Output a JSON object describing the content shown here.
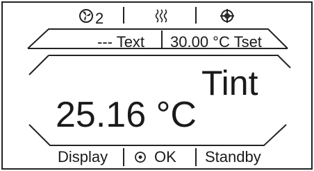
{
  "header": {
    "fan_icon": "fan-icon",
    "fan_index": "2",
    "heating_icon": "heat-waves-icon",
    "setpoint_icon": "target-icon"
  },
  "status": {
    "text": "--- Text",
    "setpoint": "30.00 °C Tset"
  },
  "main": {
    "label": "Tint",
    "temperature": "25.16 °C"
  },
  "soft_keys": {
    "display": "Display",
    "ok_icon": "radio-dot-icon",
    "ok": "OK",
    "standby": "Standby"
  }
}
